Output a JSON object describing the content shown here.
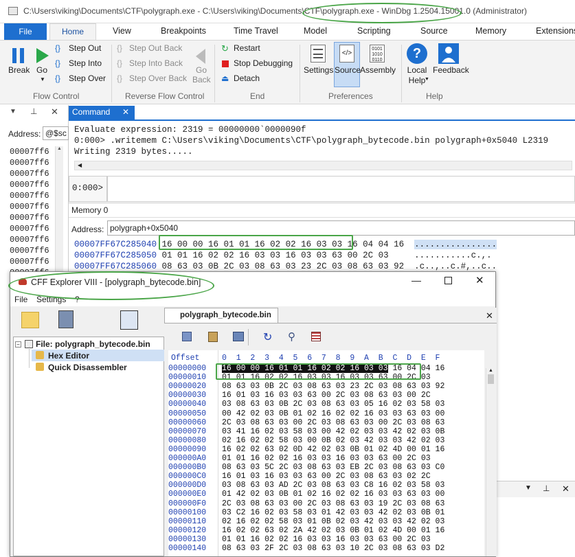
{
  "windbg": {
    "title": "C:\\Users\\viking\\Documents\\CTF\\polygraph.exe - C:\\Users\\viking\\Documents\\CTF\\polygraph.exe - WinDbg 1.2504.15001.0 (Administrator)",
    "tabs": [
      "File",
      "Home",
      "View",
      "Breakpoints",
      "Time Travel",
      "Model",
      "Scripting",
      "Source",
      "Memory",
      "Extensions"
    ],
    "ribbon": {
      "break": "Break",
      "go": "Go",
      "step_out": "Step Out",
      "step_into": "Step Into",
      "step_over": "Step Over",
      "step_out_back": "Step Out Back",
      "step_into_back": "Step Into Back",
      "step_over_back": "Step Over Back",
      "go_back": "Go Back",
      "restart": "Restart",
      "stop_debugging": "Stop Debugging",
      "detach": "Detach",
      "settings": "Settings",
      "source": "Source",
      "assembly": "Assembly",
      "local_help": "Local Help",
      "feedback": "Feedback",
      "groups": [
        "Flow Control",
        "Reverse Flow Control",
        "End",
        "Preferences",
        "Help"
      ]
    },
    "left_panel": {
      "address_label": "Address:",
      "address_value": "@$sc",
      "lines": [
        "00007ff6",
        "00007ff6",
        "00007ff6",
        "00007ff6",
        "00007ff6",
        "00007ff6",
        "00007ff6",
        "00007ff6",
        "00007ff6",
        "00007ff6",
        "00007ff6",
        "00007ff6"
      ]
    },
    "command": {
      "tab_label": "Command",
      "lines": [
        "Evaluate expression: 2319 = 00000000`0000090f",
        "0:000> .writemem C:\\Users\\viking\\Documents\\CTF\\polygraph_bytecode.bin polygraph+0x5040 L2319",
        "Writing 2319 bytes....."
      ],
      "prompt": "0:000>"
    },
    "memory": {
      "title": "Memory 0",
      "address_label": "Address:",
      "address_value": "polygraph+0x5040",
      "rows": [
        {
          "addr": "00007FF67C285040",
          "bytes": "16 00 00 16 01 01 16 02 02 16 03 03 16 04 04 16",
          "ascii": "................"
        },
        {
          "addr": "00007FF67C285050",
          "bytes": "01 01 16 02 02 16 03 03 16 03 03 63 00 2C 03",
          "ascii": "...........c.,."
        },
        {
          "addr": "00007FF67C285060",
          "bytes": "08 63 03 0B 2C 03 08 63 03 23 2C 03 08 63 03 92",
          "ascii": ".c..,..c.#,..c.."
        }
      ]
    }
  },
  "cff": {
    "title": "CFF Explorer VIII - [polygraph_bytecode.bin]",
    "menu": [
      "File",
      "Settings",
      "?"
    ],
    "tree": {
      "root": "File: polygraph_bytecode.bin",
      "children": [
        "Hex Editor",
        "Quick Disassembler"
      ]
    },
    "doc_tab": "polygraph_bytecode.bin",
    "hex_header": {
      "offset": "Offset",
      "cols": [
        "0",
        "1",
        "2",
        "3",
        "4",
        "5",
        "6",
        "7",
        "8",
        "9",
        "A",
        "B",
        "C",
        "D",
        "E",
        "F"
      ]
    },
    "hex_rows": [
      {
        "off": "00000000",
        "bytes": "16 00 00 16 01 01 16 02 02 16 03 03 16 04 04 16"
      },
      {
        "off": "00000010",
        "bytes": "01 01 16 02 02 16 03 03 16 03 03 63 00 2C 03"
      },
      {
        "off": "00000020",
        "bytes": "08 63 03 0B 2C 03 08 63 03 23 2C 03 08 63 03 92"
      },
      {
        "off": "00000030",
        "bytes": "16 01 03 16 03 03 63 00 2C 03 08 63 03 00 2C"
      },
      {
        "off": "00000040",
        "bytes": "03 08 63 03 0B 2C 03 08 63 03 05 16 02 03 58 03"
      },
      {
        "off": "00000050",
        "bytes": "00 42 02 03 0B 01 02 16 02 02 16 03 03 63 03 00"
      },
      {
        "off": "00000060",
        "bytes": "2C 03 08 63 03 00 2C 03 08 63 03 00 2C 03 08 63"
      },
      {
        "off": "00000070",
        "bytes": "03 41 16 02 03 58 03 00 42 02 03 03 42 02 03 0B"
      },
      {
        "off": "00000080",
        "bytes": "02 16 02 02 58 03 00 0B 02 03 42 03 03 42 02 03"
      },
      {
        "off": "00000090",
        "bytes": "16 02 02 63 02 0D 42 02 03 0B 01 02 4D 00 01 16"
      },
      {
        "off": "000000A0",
        "bytes": "01 01 16 02 02 16 03 03 16 03 03 63 00 2C 03"
      },
      {
        "off": "000000B0",
        "bytes": "08 63 03 5C 2C 03 08 63 03 EB 2C 03 08 63 03 C0"
      },
      {
        "off": "000000C0",
        "bytes": "16 01 03 16 03 03 63 00 2C 03 08 63 03 02 2C"
      },
      {
        "off": "000000D0",
        "bytes": "03 08 63 03 AD 2C 03 08 63 03 C8 16 02 03 58 03"
      },
      {
        "off": "000000E0",
        "bytes": "01 42 02 03 0B 01 02 16 02 02 16 03 03 63 03 00"
      },
      {
        "off": "000000F0",
        "bytes": "2C 03 08 63 03 00 2C 03 08 63 03 19 2C 03 08 63"
      },
      {
        "off": "00000100",
        "bytes": "03 C2 16 02 03 58 03 01 42 03 03 42 02 03 0B 01"
      },
      {
        "off": "00000110",
        "bytes": "02 16 02 02 58 03 01 0B 02 03 42 03 03 42 02 03"
      },
      {
        "off": "00000120",
        "bytes": "16 02 02 63 02 2A 42 02 03 0B 01 02 4D 00 01 16"
      },
      {
        "off": "00000130",
        "bytes": "01 01 16 02 02 16 03 03 16 03 03 63 00 2C 03"
      },
      {
        "off": "00000140",
        "bytes": "08 63 03 2F 2C 03 08 63 03 10 2C 03 08 63 03 D2"
      }
    ]
  }
}
